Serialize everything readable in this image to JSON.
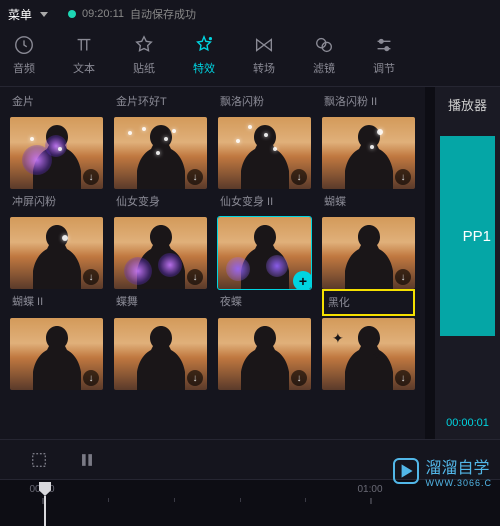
{
  "topbar": {
    "menu_label": "菜单",
    "autosave_time": "09:20:11",
    "autosave_text": "自动保存成功"
  },
  "tabs": {
    "items": [
      {
        "label": "音频",
        "icon": "clock"
      },
      {
        "label": "文本",
        "icon": "text"
      },
      {
        "label": "贴纸",
        "icon": "star"
      },
      {
        "label": "特效",
        "icon": "sparkle-star",
        "active": true
      },
      {
        "label": "转场",
        "icon": "bowtie"
      },
      {
        "label": "滤镜",
        "icon": "overlap"
      },
      {
        "label": "调节",
        "icon": "sliders"
      }
    ]
  },
  "effects": {
    "row0_labels": [
      "金片",
      "金片环好T",
      "飘洛闪粉",
      "飘洛闪粉 II"
    ],
    "row1_labels": [
      "冲屏闪粉",
      "仙女变身",
      "仙女变身 II",
      "蝴蝶"
    ],
    "row2_labels": [
      "蝴蝶 II",
      "蝶舞",
      "夜蝶",
      "黑化"
    ],
    "highlight_label": "黑化"
  },
  "preview": {
    "title": "播放器",
    "canvas_text": "PP1",
    "time_current": "00:00:01",
    "time_sep": " "
  },
  "timeline": {
    "ticks": [
      "00:00",
      "01:00"
    ]
  },
  "watermark": {
    "name": "溜溜自学",
    "sub": "WWW.3066.C"
  }
}
